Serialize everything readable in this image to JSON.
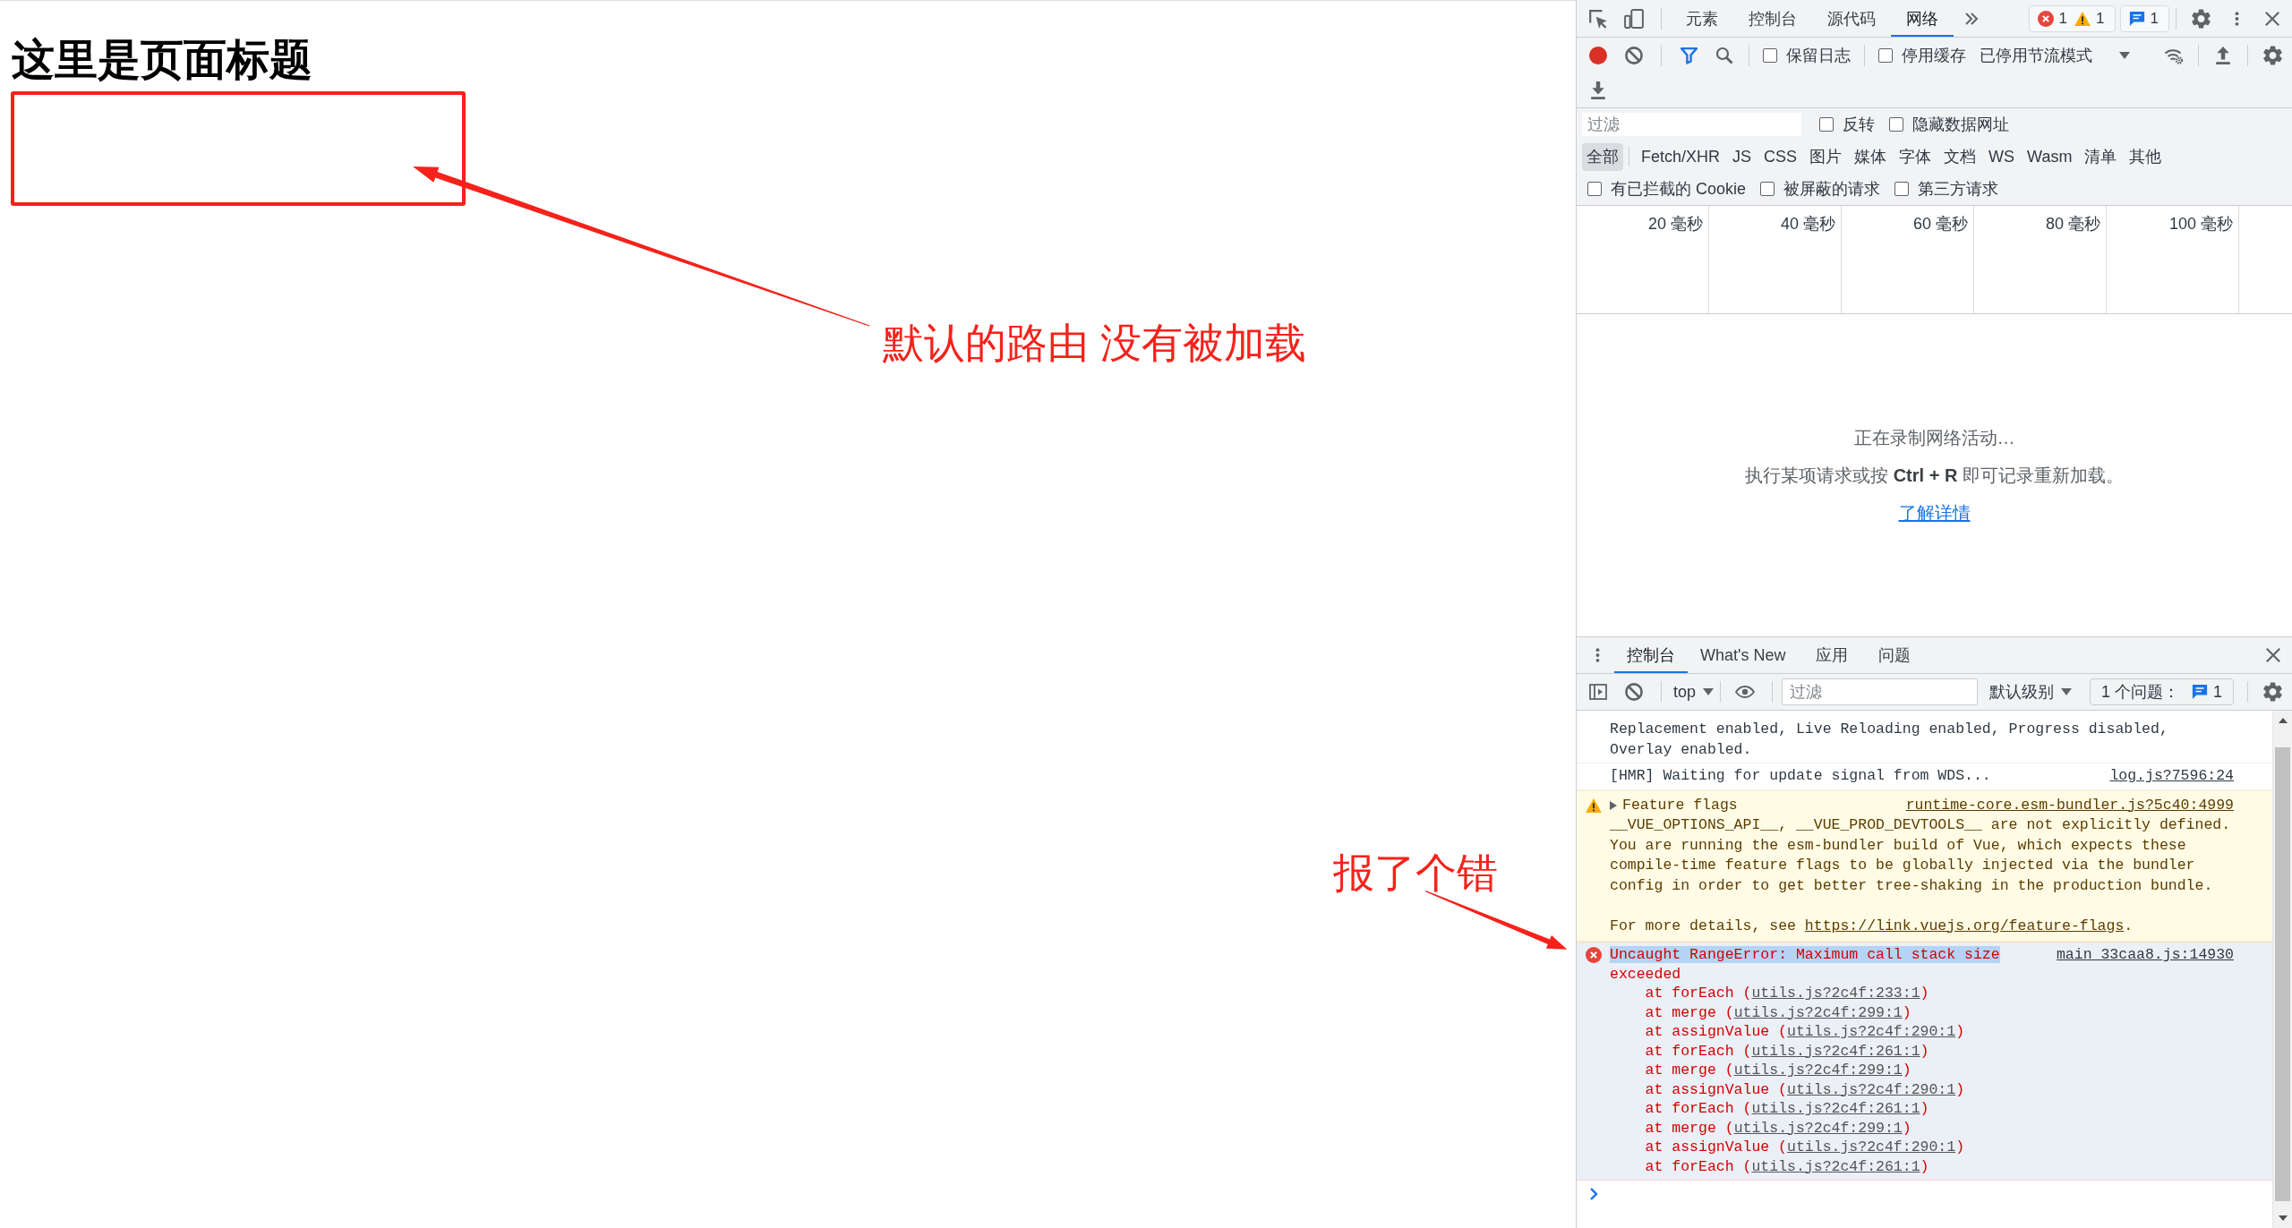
{
  "page": {
    "title": "这里是页面标题"
  },
  "annotations": [
    {
      "kind": "box_pointer",
      "text": "默认的路由 没有被加载"
    },
    {
      "kind": "message_pointer",
      "text": "报了个错"
    }
  ],
  "devtools": {
    "tabs": [
      {
        "label": "元素",
        "selected": false
      },
      {
        "label": "控制台",
        "selected": false
      },
      {
        "label": "源代码",
        "selected": false
      },
      {
        "label": "网络",
        "selected": true
      }
    ],
    "counters": [
      {
        "kind": "error",
        "count": "1"
      },
      {
        "kind": "warning",
        "count": "1"
      }
    ],
    "messages_counter": {
      "count": "1"
    },
    "network": {
      "recording": true,
      "filter_active": true,
      "toolbar_options": [
        {
          "label": "保留日志",
          "checked": false
        },
        {
          "label": "停用缓存",
          "checked": false
        }
      ],
      "throttling": "已停用节流模式",
      "filter": {
        "placeholder": "过滤"
      },
      "filter_options": [
        {
          "label": "反转",
          "checked": false
        },
        {
          "label": "隐藏数据网址",
          "checked": false
        }
      ],
      "type_filters": [
        {
          "label": "全部",
          "selected": true
        },
        {
          "label": "Fetch/XHR",
          "selected": false
        },
        {
          "label": "JS",
          "selected": false
        },
        {
          "label": "CSS",
          "selected": false
        },
        {
          "label": "图片",
          "selected": false
        },
        {
          "label": "媒体",
          "selected": false
        },
        {
          "label": "字体",
          "selected": false
        },
        {
          "label": "文档",
          "selected": false
        },
        {
          "label": "WS",
          "selected": false
        },
        {
          "label": "Wasm",
          "selected": false
        },
        {
          "label": "清单",
          "selected": false
        },
        {
          "label": "其他",
          "selected": false
        }
      ],
      "request_filters": [
        {
          "label": "有已拦截的 Cookie",
          "checked": false
        },
        {
          "label": "被屏蔽的请求",
          "checked": false
        },
        {
          "label": "第三方请求",
          "checked": false
        }
      ],
      "timeline_ticks": [
        "20 毫秒",
        "40 毫秒",
        "60 毫秒",
        "80 毫秒",
        "100 毫秒"
      ],
      "empty_state": {
        "title": "正在录制网络活动…",
        "hint": "执行某项请求或按 **Ctrl + R** 即可记录重新加载。",
        "link": "了解详情"
      }
    },
    "drawer": {
      "tabs": [
        {
          "label": "控制台",
          "selected": true
        },
        {
          "label": "What's New",
          "selected": false
        },
        {
          "label": "应用",
          "selected": false
        },
        {
          "label": "问题",
          "selected": false
        }
      ],
      "console": {
        "context": "top",
        "filter": {
          "placeholder": "过滤"
        },
        "levels": "默认级别",
        "issues": {
          "label": "1 个问题：",
          "count": "1"
        },
        "messages": [
          {
            "kind": "info",
            "selected": false,
            "text": "Replacement enabled, Live Reloading enabled, Progress disabled, Overlay enabled."
          },
          {
            "kind": "info",
            "selected": false,
            "text": "[HMR] Waiting for update signal from WDS...",
            "source": "log.js?7596:24"
          },
          {
            "kind": "warning",
            "selected": false,
            "expanded": false,
            "title": "Feature flags",
            "source": "runtime-core.esm-bundler.js?5c40:4999",
            "text": "__VUE_OPTIONS_API__, __VUE_PROD_DEVTOOLS__ are not explicitly defined. You are running the esm-bundler build of Vue, which expects these compile-time feature flags to be globally injected via the bundler config in order to get better tree-shaking in the production bundle.",
            "details": {
              "text": "For more details, see ",
              "link": "https://link.vuejs.org/feature-flags",
              "after": "."
            }
          },
          {
            "kind": "error",
            "selected": true,
            "text": "Uncaught RangeError: Maximum call stack size exceeded",
            "source": "main_33caa8.js:14930",
            "stack": [
              {
                "text": "at forEach (",
                "link": "utils.js?2c4f:233:1",
                "after": ")"
              },
              {
                "text": "at merge (",
                "link": "utils.js?2c4f:299:1",
                "after": ")"
              },
              {
                "text": "at assignValue (",
                "link": "utils.js?2c4f:290:1",
                "after": ")"
              },
              {
                "text": "at forEach (",
                "link": "utils.js?2c4f:261:1",
                "after": ")"
              },
              {
                "text": "at merge (",
                "link": "utils.js?2c4f:299:1",
                "after": ")"
              },
              {
                "text": "at assignValue (",
                "link": "utils.js?2c4f:290:1",
                "after": ")"
              },
              {
                "text": "at forEach (",
                "link": "utils.js?2c4f:261:1",
                "after": ")"
              },
              {
                "text": "at merge (",
                "link": "utils.js?2c4f:299:1",
                "after": ")"
              },
              {
                "text": "at assignValue (",
                "link": "utils.js?2c4f:290:1",
                "after": ")"
              },
              {
                "text": "at forEach (",
                "link": "utils.js?2c4f:261:1",
                "after": ")"
              }
            ]
          }
        ]
      }
    }
  }
}
